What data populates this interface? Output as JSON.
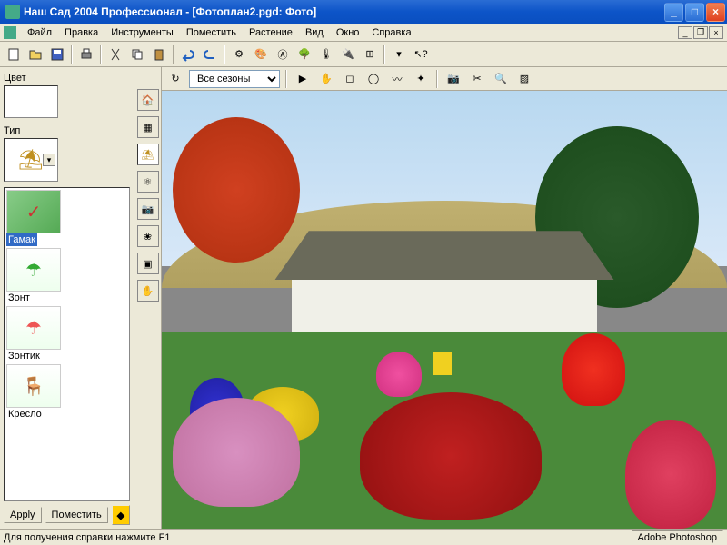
{
  "window": {
    "title": "Наш Сад 2004 Профессионал - [Фотоплан2.pgd: Фото]"
  },
  "menu": {
    "file": "Файл",
    "edit": "Правка",
    "tools": "Инструменты",
    "place": "Поместить",
    "plant": "Растение",
    "view": "Вид",
    "window": "Окно",
    "help": "Справка"
  },
  "left_panel": {
    "color_label": "Цвет",
    "type_label": "Тип",
    "items": [
      {
        "label": "Гамак",
        "glyph": "⛱"
      },
      {
        "label": "Зонт",
        "glyph": "☂"
      },
      {
        "label": "Зонтик",
        "glyph": "☂"
      },
      {
        "label": "Кресло",
        "glyph": "🪑"
      }
    ],
    "apply_label": "Apply",
    "place_label": "Поместить"
  },
  "tool_column": {
    "icons": [
      "house-icon",
      "fence-icon",
      "flower-icon",
      "nodes-icon",
      "camera-icon",
      "plant-icon",
      "frame-icon",
      "hand-icon"
    ]
  },
  "toolbar2": {
    "season_selected": "Все сезоны"
  },
  "statusbar": {
    "help_text": "Для получения справки нажмите F1",
    "app_hint": "Adobe Photoshop"
  },
  "colors": {
    "titlebar": "#0d54c8",
    "panel": "#ece9d8"
  }
}
